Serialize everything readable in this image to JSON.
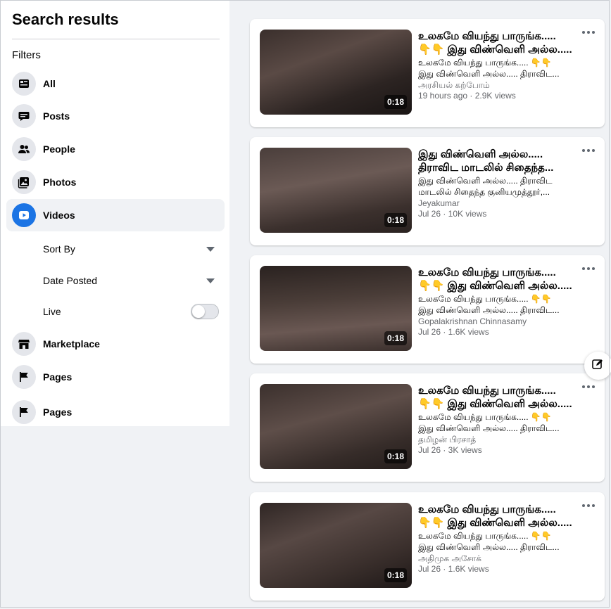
{
  "sidebar": {
    "title": "Search results",
    "filters_label": "Filters",
    "items": [
      {
        "label": "All",
        "icon": "feed-icon"
      },
      {
        "label": "Posts",
        "icon": "chat-bubble-icon"
      },
      {
        "label": "People",
        "icon": "people-icon"
      },
      {
        "label": "Photos",
        "icon": "photos-icon"
      },
      {
        "label": "Videos",
        "icon": "video-play-icon",
        "active": true
      },
      {
        "label": "Marketplace",
        "icon": "storefront-icon"
      },
      {
        "label": "Pages",
        "icon": "flag-icon"
      },
      {
        "label": "Pages",
        "icon": "flag-icon"
      }
    ],
    "sort_by": "Sort By",
    "date_posted": "Date Posted",
    "live": "Live",
    "live_on": false
  },
  "results": [
    {
      "title": "உலகமே வியந்து பாருங்க.....\n👇👇 இது விண்வெளி அல்ல.....",
      "desc": "உலகமே வியந்து பாருங்க..... 👇👇\nஇது விண்வெளி அல்ல..... திராவிட...",
      "author": "அரசியல் கற்போம்",
      "meta": "19 hours ago · 2.9K views",
      "duration": "0:18"
    },
    {
      "title": "இது விண்வெளி அல்ல.....\nதிராவிட மாடலில் சிதைந்த...",
      "desc": "இது விண்வெளி அல்ல..... திராவிட\nமாடலில் சிதைந்த குனியமுத்தூர்,...",
      "author": "Jeyakumar",
      "meta": "Jul 26 · 10K views",
      "duration": "0:18"
    },
    {
      "title": "உலகமே வியந்து பாருங்க.....\n👇👇 இது விண்வெளி அல்ல.....",
      "desc": "உலகமே வியந்து பாருங்க..... 👇👇\nஇது விண்வெளி அல்ல..... திராவிட...",
      "author": "Gopalakrishnan Chinnasamy",
      "meta": "Jul 26 · 1.6K views",
      "duration": "0:18"
    },
    {
      "title": "உலகமே வியந்து பாருங்க.....\n👇👇 இது விண்வெளி அல்ல.....",
      "desc": "உலகமே வியந்து பாருங்க..... 👇👇\nஇது விண்வெளி அல்ல..... திராவிட...",
      "author": "தமிழன் பிரசாத்",
      "meta": "Jul 26 · 3K views",
      "duration": "0:18"
    },
    {
      "title": "உலகமே வியந்து பாருங்க.....\n👇👇 இது விண்வெளி அல்ல.....",
      "desc": "உலகமே வியந்து பாருங்க..... 👇👇\nஇது விண்வெளி அல்ல..... திராவிட...",
      "author": "அதிமுக அசோக்",
      "meta": "Jul 26 · 1.6K views",
      "duration": "0:18"
    }
  ],
  "colors": {
    "accent": "#1b74e4",
    "page_bg": "#f0f2f5",
    "secondary_text": "#65676b"
  }
}
